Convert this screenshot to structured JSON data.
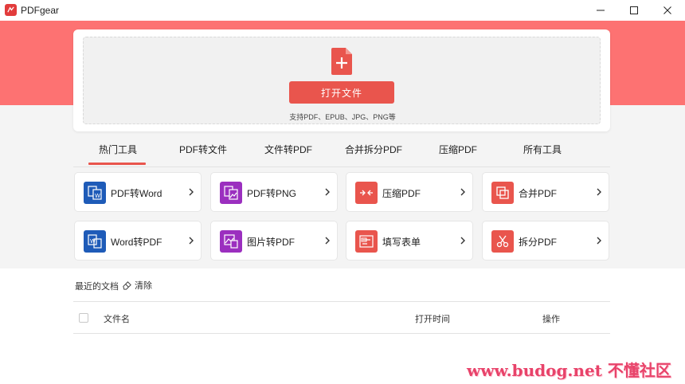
{
  "app": {
    "title": "PDFgear",
    "logo_icon": "pdfgear-logo-icon"
  },
  "window_controls": {
    "minimize_icon": "minimize-icon",
    "maximize_icon": "maximize-icon",
    "close_icon": "close-icon"
  },
  "upload": {
    "button_label": "打开文件",
    "formats_hint": "支持PDF、EPUB、JPG、PNG等",
    "icon": "file-plus-icon"
  },
  "tabs": [
    {
      "label": "热门工具",
      "active": true
    },
    {
      "label": "PDF转文件",
      "active": false
    },
    {
      "label": "文件转PDF",
      "active": false
    },
    {
      "label": "合并拆分PDF",
      "active": false
    },
    {
      "label": "压缩PDF",
      "active": false
    },
    {
      "label": "所有工具",
      "active": false
    }
  ],
  "tools": [
    {
      "label": "PDF转Word",
      "icon": "pdf-to-word-icon",
      "color": "#1e5bb8"
    },
    {
      "label": "PDF转PNG",
      "icon": "pdf-to-png-icon",
      "color": "#9b2fbf"
    },
    {
      "label": "压缩PDF",
      "icon": "compress-icon",
      "color": "#e9554d"
    },
    {
      "label": "合并PDF",
      "icon": "merge-icon",
      "color": "#e9554d"
    },
    {
      "label": "Word转PDF",
      "icon": "word-to-pdf-icon",
      "color": "#1e5bb8"
    },
    {
      "label": "图片转PDF",
      "icon": "image-to-pdf-icon",
      "color": "#9b2fbf"
    },
    {
      "label": "填写表单",
      "icon": "fill-form-icon",
      "color": "#e9554d"
    },
    {
      "label": "拆分PDF",
      "icon": "split-icon",
      "color": "#e9554d"
    }
  ],
  "recent": {
    "title": "最近的文档",
    "clear_label": "清除",
    "columns": {
      "name": "文件名",
      "opened": "打开时间",
      "actions": "操作"
    }
  },
  "colors": {
    "accent": "#e9554d",
    "banner": "#fd7272",
    "background_gray": "#f4f4f4"
  },
  "watermark": "www.budog.net 不懂社区"
}
